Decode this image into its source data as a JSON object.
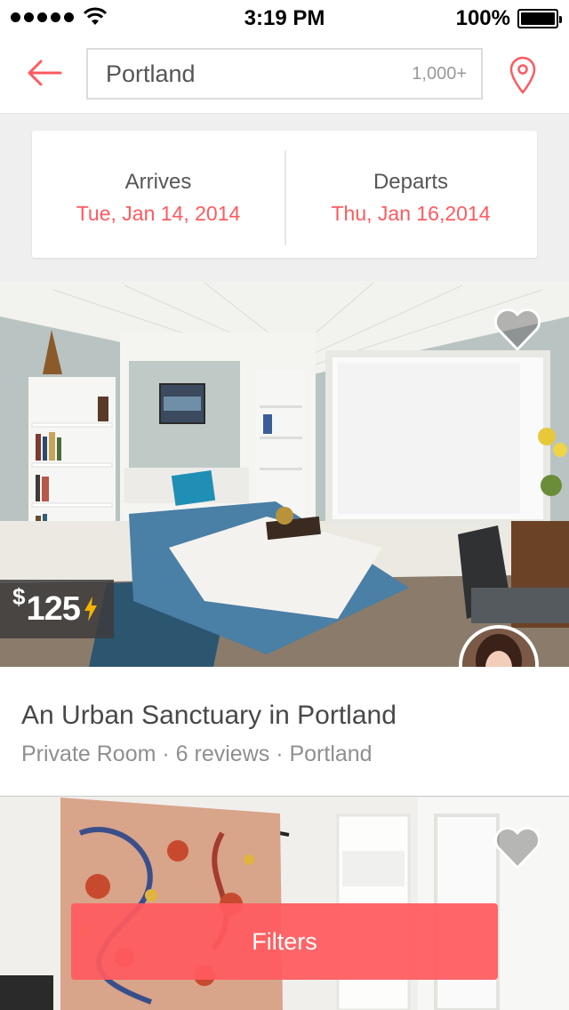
{
  "status_bar": {
    "time": "3:19 PM",
    "battery_percent": "100%",
    "signal_bars": 5,
    "icons": [
      "signal-dots-icon",
      "wifi-icon",
      "battery-icon"
    ]
  },
  "header": {
    "back_icon": "back-arrow-icon",
    "search": {
      "value": "Portland",
      "result_count": "1,000+"
    },
    "map_icon": "map-pin-icon"
  },
  "dates": {
    "arrives_label": "Arrives",
    "arrives_value": "Tue, Jan 14, 2014",
    "departs_label": "Departs",
    "departs_value": "Thu, Jan 16,2014"
  },
  "listings": [
    {
      "price": "125",
      "currency_symbol": "$",
      "instant_book_icon": "lightning-bolt-icon",
      "favorite_icon": "heart-icon",
      "title": "An Urban Sanctuary in Portland",
      "meta": "Private Room · 6 reviews · Portland",
      "host_avatar": "host-avatar"
    },
    {
      "favorite_icon": "heart-icon"
    }
  ],
  "filters_button": {
    "label": "Filters"
  },
  "colors": {
    "accent": "#ff5a5f",
    "text_dark": "#484848",
    "text_muted": "#8f8f8f",
    "background": "#efefef",
    "instant_book": "#f5b400"
  }
}
